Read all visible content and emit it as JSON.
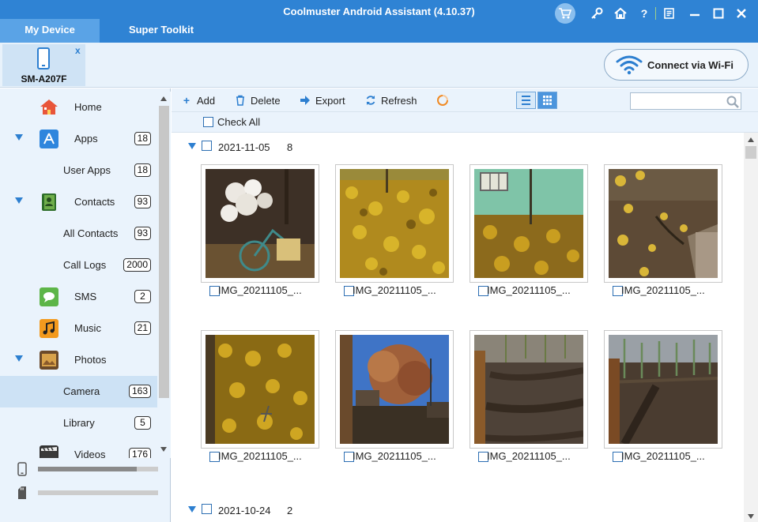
{
  "app": {
    "title": "Coolmuster Android Assistant (4.10.37)",
    "tabs": [
      "My Device",
      "Super Toolkit"
    ],
    "active_tab": "My Device",
    "title_icons": [
      "cart-icon",
      "key-icon",
      "home-icon",
      "help-icon",
      "feedback-icon",
      "minimize-icon",
      "maximize-icon",
      "close-icon"
    ]
  },
  "device": {
    "name": "SM-A207F",
    "close_label": "x",
    "wifi_button_label": "Connect via Wi-Fi"
  },
  "sidebar": {
    "items": [
      {
        "label": "Home",
        "icon": "home-icon",
        "count": null,
        "level": "top"
      },
      {
        "label": "Apps",
        "icon": "apps-icon",
        "count": "18",
        "level": "top",
        "expanded": true
      },
      {
        "label": "User Apps",
        "count": "18",
        "level": "sub"
      },
      {
        "label": "Contacts",
        "icon": "contacts-icon",
        "count": "93",
        "level": "top",
        "expanded": true
      },
      {
        "label": "All Contacts",
        "count": "93",
        "level": "sub"
      },
      {
        "label": "Call Logs",
        "count": "2000",
        "level": "sub"
      },
      {
        "label": "SMS",
        "icon": "sms-icon",
        "count": "2",
        "level": "top"
      },
      {
        "label": "Music",
        "icon": "music-icon",
        "count": "21",
        "level": "top"
      },
      {
        "label": "Photos",
        "icon": "photos-icon",
        "count": null,
        "level": "top",
        "expanded": true
      },
      {
        "label": "Camera",
        "count": "163",
        "level": "sub",
        "selected": true
      },
      {
        "label": "Library",
        "count": "5",
        "level": "sub"
      },
      {
        "label": "Videos",
        "icon": "videos-icon",
        "count": "176",
        "level": "top"
      }
    ],
    "storage": [
      {
        "icon": "phone-storage-icon",
        "used_fraction": 0.82
      },
      {
        "icon": "sd-card-icon",
        "used_fraction": 0.0
      }
    ]
  },
  "toolbar": {
    "add": "Add",
    "delete": "Delete",
    "export": "Export",
    "refresh": "Refresh",
    "search_value": "",
    "search_placeholder": ""
  },
  "check_all_label": "Check All",
  "groups": [
    {
      "date": "2021-11-05",
      "count": "8",
      "photos": [
        {
          "name": "IMG_20211105_...",
          "scene": "flowers-bike"
        },
        {
          "name": "IMG_20211105_...",
          "scene": "leaves"
        },
        {
          "name": "IMG_20211105_...",
          "scene": "wall-leaves"
        },
        {
          "name": "IMG_20211105_...",
          "scene": "ground-leaves"
        },
        {
          "name": "IMG_20211105_...",
          "scene": "leaves-dark"
        },
        {
          "name": "IMG_20211105_...",
          "scene": "tree-sky"
        },
        {
          "name": "IMG_20211105_...",
          "scene": "soil-rows"
        },
        {
          "name": "IMG_20211105_...",
          "scene": "soil-fence"
        }
      ]
    },
    {
      "date": "2021-10-24",
      "count": "2",
      "photos": []
    }
  ],
  "colors": {
    "title_bar": "#2f83d4",
    "accent": "#2d7fd0",
    "sidebar_bg": "#eaf3fc",
    "selected_bg": "#cde2f5"
  }
}
